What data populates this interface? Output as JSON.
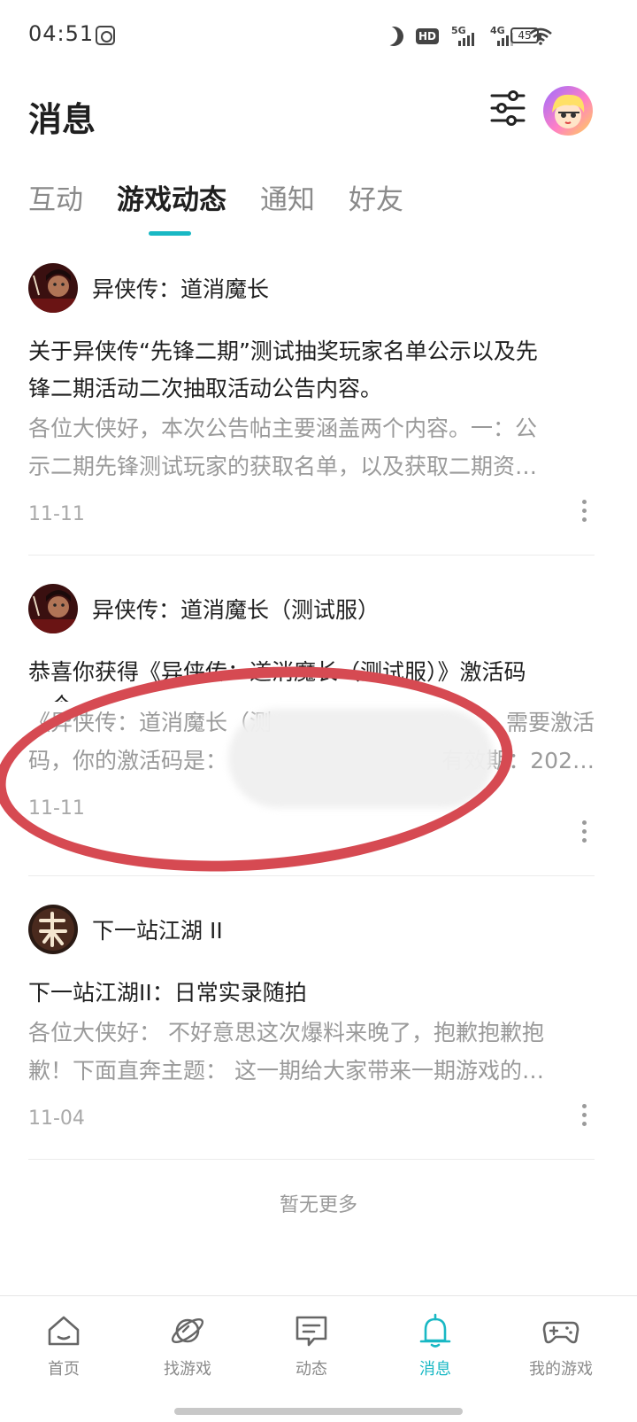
{
  "status_bar": {
    "time": "04:51",
    "hd": "HD",
    "net1": "5G",
    "net2": "4G",
    "battery": "45"
  },
  "header": {
    "title": "消息",
    "filter_icon": "sliders-icon",
    "avatar_icon": "user-avatar"
  },
  "tabs": [
    {
      "label": "互动",
      "active": false
    },
    {
      "label": "游戏动态",
      "active": true
    },
    {
      "label": "通知",
      "active": false
    },
    {
      "label": "好友",
      "active": false
    }
  ],
  "messages": [
    {
      "game": "异侠传：道消魔长",
      "title_line1": "关于异侠传“先锋二期”测试抽奖玩家名单公示以及先",
      "title_line2": "锋二期活动二次抽取活动公告内容。",
      "summary_line1": "各位大侠好，本次公告帖主要涵盖两个内容。一：公",
      "summary_line2": "示二期先锋测试玩家的获取名单，以及获取二期资…",
      "date": "11-11"
    },
    {
      "game": "异侠传：道消魔长（测试服）",
      "title_line1": "恭喜你获得《异侠传：道消魔长（测试服）》激活码",
      "title_line2": "一个",
      "summary_line1": "《异侠传：道消魔长（测",
      "summary_line1_end": "需要激活",
      "summary_line2": "码，你的激活码是：",
      "summary_line2_end": "有效期：202…",
      "date": "11-11"
    },
    {
      "game": "下一站江湖 II",
      "title_line1": "下一站江湖II：日常实录随拍",
      "summary_line1": "各位大侠好： 不好意思这次爆料来晚了，抱歉抱歉抱",
      "summary_line2": "歉！下面直奔主题： 这一期给大家带来一期游戏的…",
      "date": "11-04"
    }
  ],
  "footer_text": "暂无更多",
  "bottom_nav": [
    {
      "label": "首页",
      "icon": "home-icon"
    },
    {
      "label": "找游戏",
      "icon": "planet-icon"
    },
    {
      "label": "动态",
      "icon": "chat-icon"
    },
    {
      "label": "消息",
      "icon": "bell-icon",
      "active": true
    },
    {
      "label": "我的游戏",
      "icon": "gamepad-icon"
    }
  ],
  "colors": {
    "accent": "#19b8c4",
    "annotation_red": "#d64a52"
  }
}
